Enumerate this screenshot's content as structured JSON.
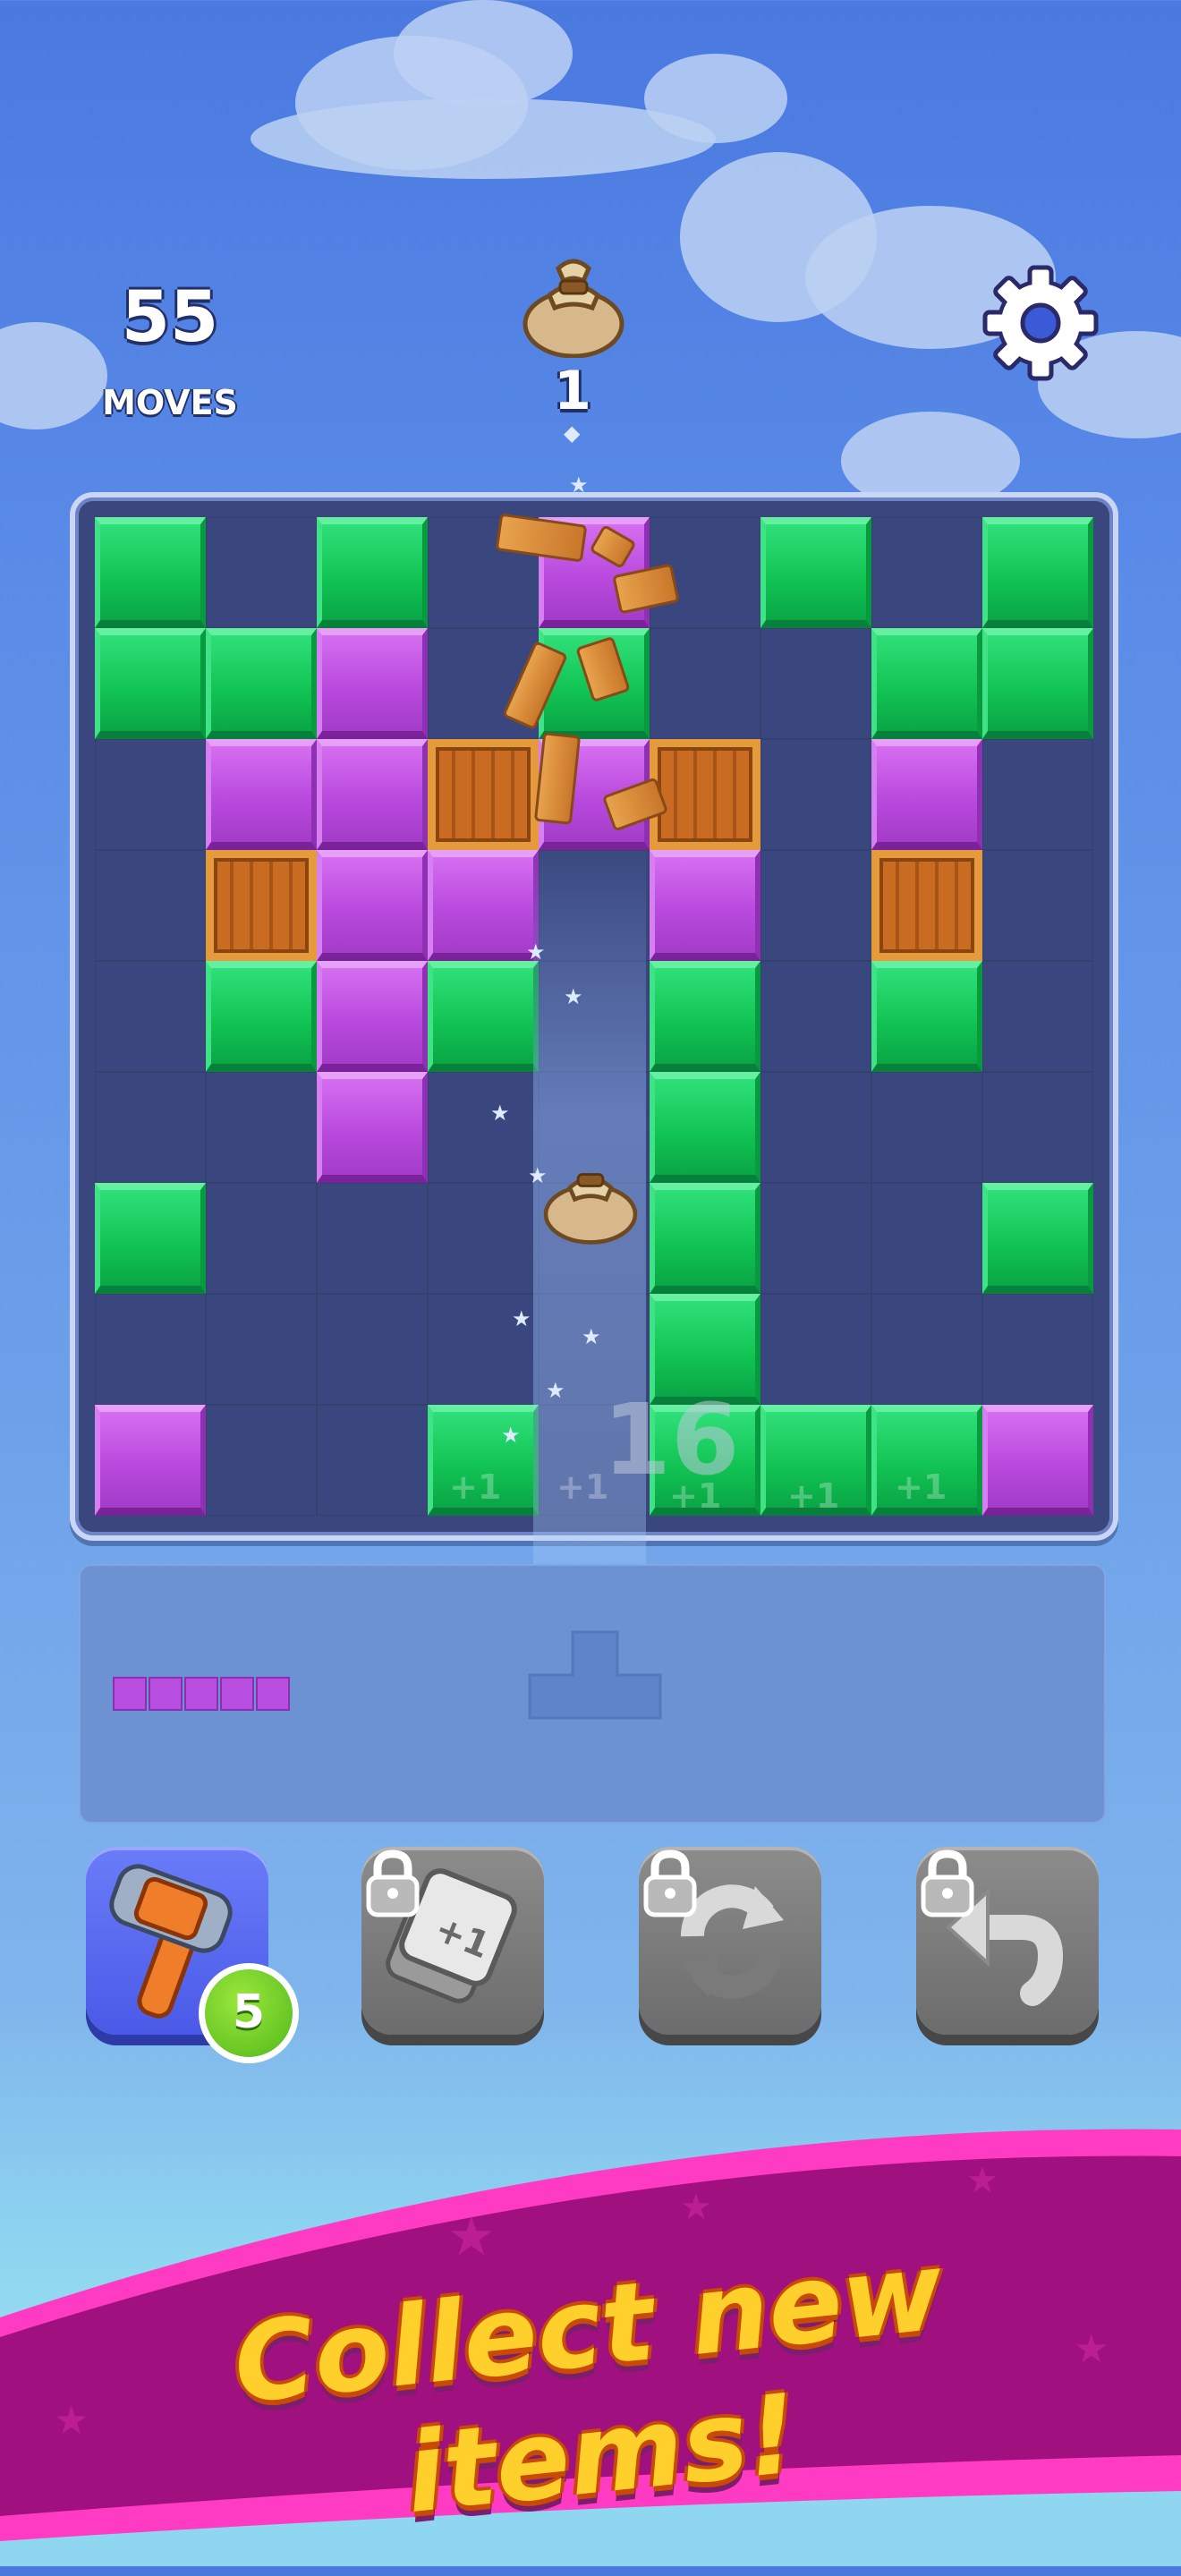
{
  "hud": {
    "moves_count": "55",
    "moves_label": "MOVES",
    "goal_item": "sack-icon",
    "goal_count": "1",
    "settings_icon": "gear-icon"
  },
  "board": {
    "rows": 9,
    "cols": 9,
    "legend": {
      "G": "green-block",
      "P": "purple-block",
      "C": "wooden-crate",
      ".": "empty"
    },
    "cells": [
      "G.G.P.G.G",
      "GGP.G..GG",
      ".PPCPC.P.",
      ".CPP.P.C.",
      ".GPG.G.G.",
      "..P..G...",
      "G....G..G",
      ".....G...",
      "P..G.GGGP"
    ],
    "falling_item": "sack-icon",
    "combo_value": "16",
    "score_popup": "+1"
  },
  "tray": {
    "pieces": [
      {
        "shape": "1x5 line",
        "color": "#b84fe0"
      },
      {
        "shape": "T-shape placeholder",
        "color": "#6c8fd0"
      }
    ]
  },
  "boosters": [
    {
      "id": "hammer",
      "icon": "hammer-icon",
      "count": "5",
      "locked": false
    },
    {
      "id": "plus-one",
      "icon": "plus-one-tile-icon",
      "tile_label": "+1",
      "locked": true
    },
    {
      "id": "shuffle",
      "icon": "shuffle-arrows-icon",
      "locked": true
    },
    {
      "id": "undo",
      "icon": "undo-arrow-icon",
      "locked": true
    }
  ],
  "banner": {
    "text": "Collect new items!",
    "colors": {
      "text": "#ffcf2b",
      "band": "#a0107e",
      "edge": "#ff3bc4"
    }
  }
}
